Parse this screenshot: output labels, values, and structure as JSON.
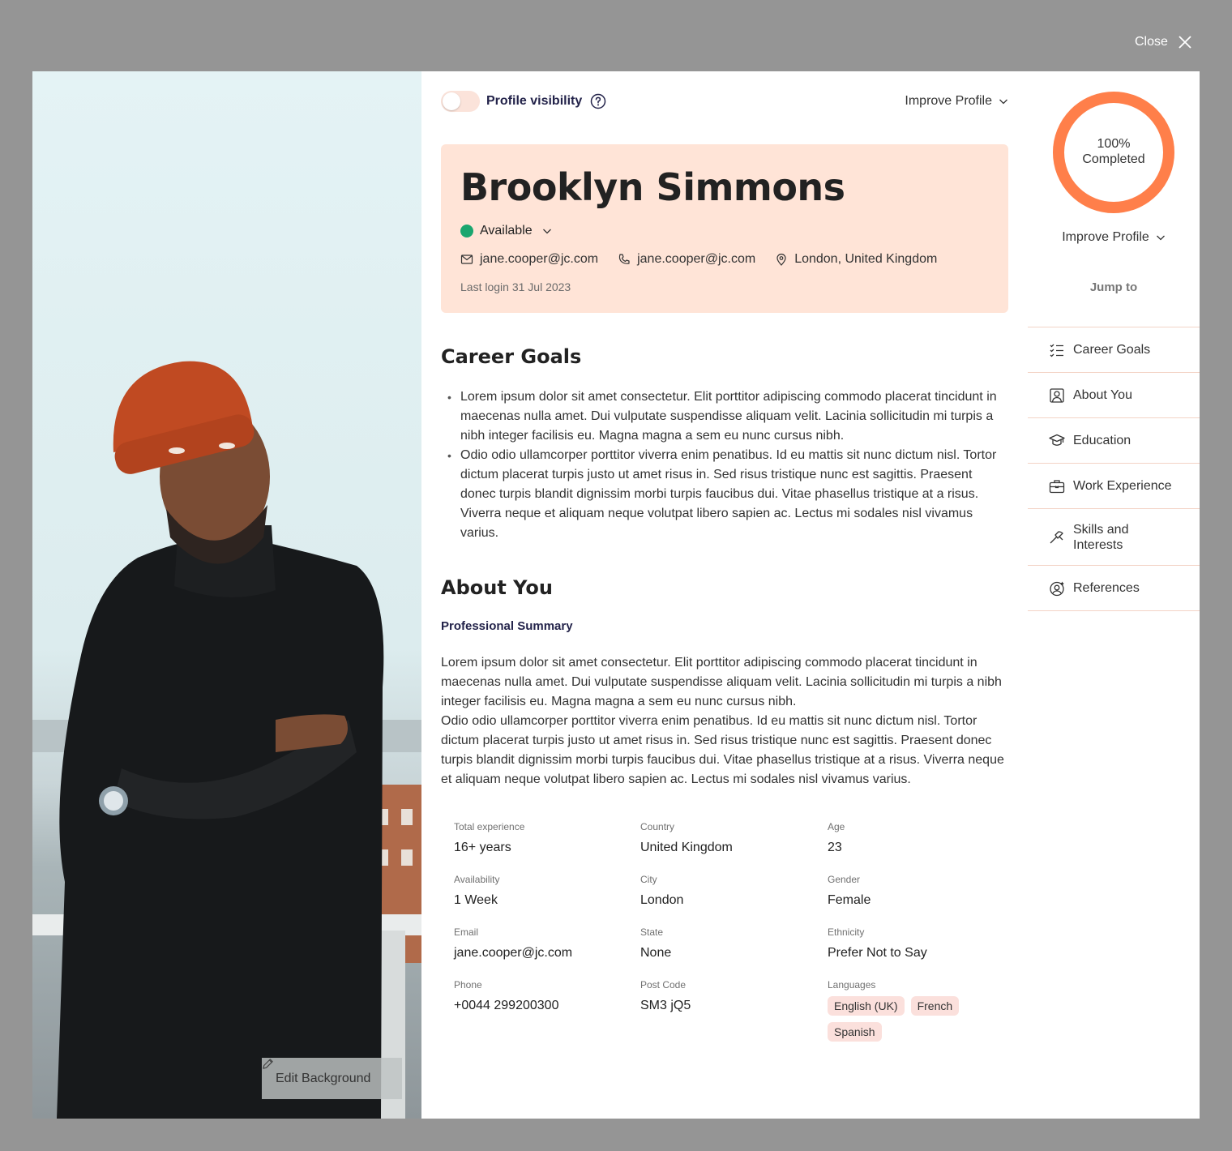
{
  "window": {
    "close_label": "Close"
  },
  "photo": {
    "edit_label": "Edit Background"
  },
  "top": {
    "visibility_label": "Profile visibility",
    "improve_label": "Improve Profile"
  },
  "profile": {
    "name": "Brooklyn Simmons",
    "status": "Available",
    "email": "jane.cooper@jc.com",
    "phone": "jane.cooper@jc.com",
    "location": "London, United Kingdom",
    "last_login": "Last login 31 Jul 2023"
  },
  "career_goals": {
    "title": "Career Goals",
    "items": [
      "Lorem ipsum dolor sit amet consectetur. Elit porttitor adipiscing commodo placerat tincidunt in maecenas nulla amet. Dui vulputate suspendisse aliquam velit. Lacinia sollicitudin mi turpis a nibh integer facilisis eu. Magna magna a sem eu nunc cursus nibh.",
      "Odio odio ullamcorper porttitor viverra enim penatibus. Id eu mattis sit nunc dictum nisl. Tortor dictum placerat turpis justo ut amet risus in. Sed risus tristique nunc est sagittis. Praesent donec turpis blandit dignissim morbi turpis faucibus dui. Vitae phasellus tristique at a risus. Viverra neque et aliquam neque volutpat libero sapien ac. Lectus mi sodales nisl vivamus varius."
    ]
  },
  "about": {
    "title": "About You",
    "subtitle": "Professional Summary",
    "summary_1": "Lorem ipsum dolor sit amet consectetur. Elit porttitor adipiscing commodo placerat tincidunt in maecenas nulla amet. Dui vulputate suspendisse aliquam velit. Lacinia sollicitudin mi turpis a nibh integer facilisis eu. Magna magna a sem eu nunc cursus nibh.",
    "summary_2": "Odio odio ullamcorper porttitor viverra enim penatibus. Id eu mattis sit nunc dictum nisl. Tortor dictum placerat turpis justo ut amet risus in. Sed risus tristique nunc est sagittis. Praesent donec turpis blandit dignissim morbi turpis faucibus dui. Vitae phasellus tristique at a risus. Viverra neque et aliquam neque volutpat libero sapien ac. Lectus mi sodales nisl vivamus varius."
  },
  "details": {
    "total_experience": {
      "label": "Total experience",
      "value": "16+ years"
    },
    "country": {
      "label": "Country",
      "value": "United Kingdom"
    },
    "age": {
      "label": "Age",
      "value": "23"
    },
    "availability": {
      "label": "Availability",
      "value": "1 Week"
    },
    "city": {
      "label": "City",
      "value": "London"
    },
    "gender": {
      "label": "Gender",
      "value": "Female"
    },
    "email": {
      "label": "Email",
      "value": "jane.cooper@jc.com"
    },
    "state": {
      "label": "State",
      "value": "None"
    },
    "ethnicity": {
      "label": "Ethnicity",
      "value": "Prefer Not to Say"
    },
    "phone": {
      "label": "Phone",
      "value": "+0044 299200300"
    },
    "post_code": {
      "label": "Post Code",
      "value": "SM3 jQ5"
    },
    "languages": {
      "label": "Languages",
      "values": [
        "English (UK)",
        "French",
        "Spanish"
      ]
    }
  },
  "sidebar": {
    "completion": {
      "percent_label": "100%",
      "text": "Completed",
      "value": 1.0
    },
    "improve_label": "Improve Profile",
    "jump_to": "Jump to",
    "nav": [
      {
        "label": "Career Goals",
        "icon": "checklist-icon"
      },
      {
        "label": "About You",
        "icon": "user-portrait-icon"
      },
      {
        "label": "Education",
        "icon": "graduation-cap-icon"
      },
      {
        "label": "Work Experience",
        "icon": "briefcase-icon"
      },
      {
        "label": "Skills and Interests",
        "icon": "hammer-icon"
      },
      {
        "label": "References",
        "icon": "user-star-icon"
      }
    ]
  },
  "colors": {
    "accent": "#ff7f4a",
    "header_bg": "#ffe4d7",
    "available": "#1aa66f",
    "heading": "#23234a"
  }
}
